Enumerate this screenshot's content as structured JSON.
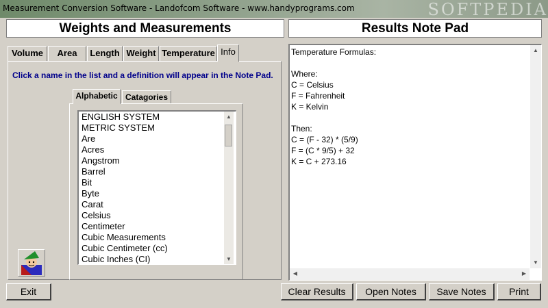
{
  "window": {
    "title": "Measurement Conversion Software - Landofcom Software - www.handyprograms.com",
    "watermark": "SOFTPEDIA"
  },
  "left_header": "Weights and Measurements",
  "right_header": "Results Note Pad",
  "tabs": [
    {
      "label": "Volume"
    },
    {
      "label": "Area"
    },
    {
      "label": "Length"
    },
    {
      "label": "Weight"
    },
    {
      "label": "Temperature"
    },
    {
      "label": "Info"
    }
  ],
  "instruction": "Click a name in the list and a definition will appear in the Note Pad.",
  "subtabs": [
    {
      "label": "Alphabetic"
    },
    {
      "label": "Catagories"
    }
  ],
  "list_items": [
    "ENGLISH SYSTEM",
    "METRIC SYSTEM",
    "Are",
    "Acres",
    "Angstrom",
    "Barrel",
    "Bit",
    "Byte",
    "Carat",
    "Celsius",
    "Centimeter",
    "Cubic Measurements",
    "Cubic Centimeter (cc)",
    "Cubic Inches (CI)"
  ],
  "notes_lines": [
    "Temperature Formulas:",
    "",
    "Where:",
    "C = Celsius",
    "F = Fahrenheit",
    "K = Kelvin",
    "",
    "Then:",
    "C = (F - 32) * (5/9)",
    "F = (C * 9/5) + 32",
    "K = C + 273.16"
  ],
  "buttons": {
    "exit": "Exit",
    "clear": "Clear Results",
    "open": "Open Notes",
    "save": "Save Notes",
    "print": "Print"
  },
  "colors": {
    "instruction_text": "#00008b",
    "window_face": "#d4d0c8"
  },
  "icons": {
    "mascot": "elf-mascot-icon"
  }
}
